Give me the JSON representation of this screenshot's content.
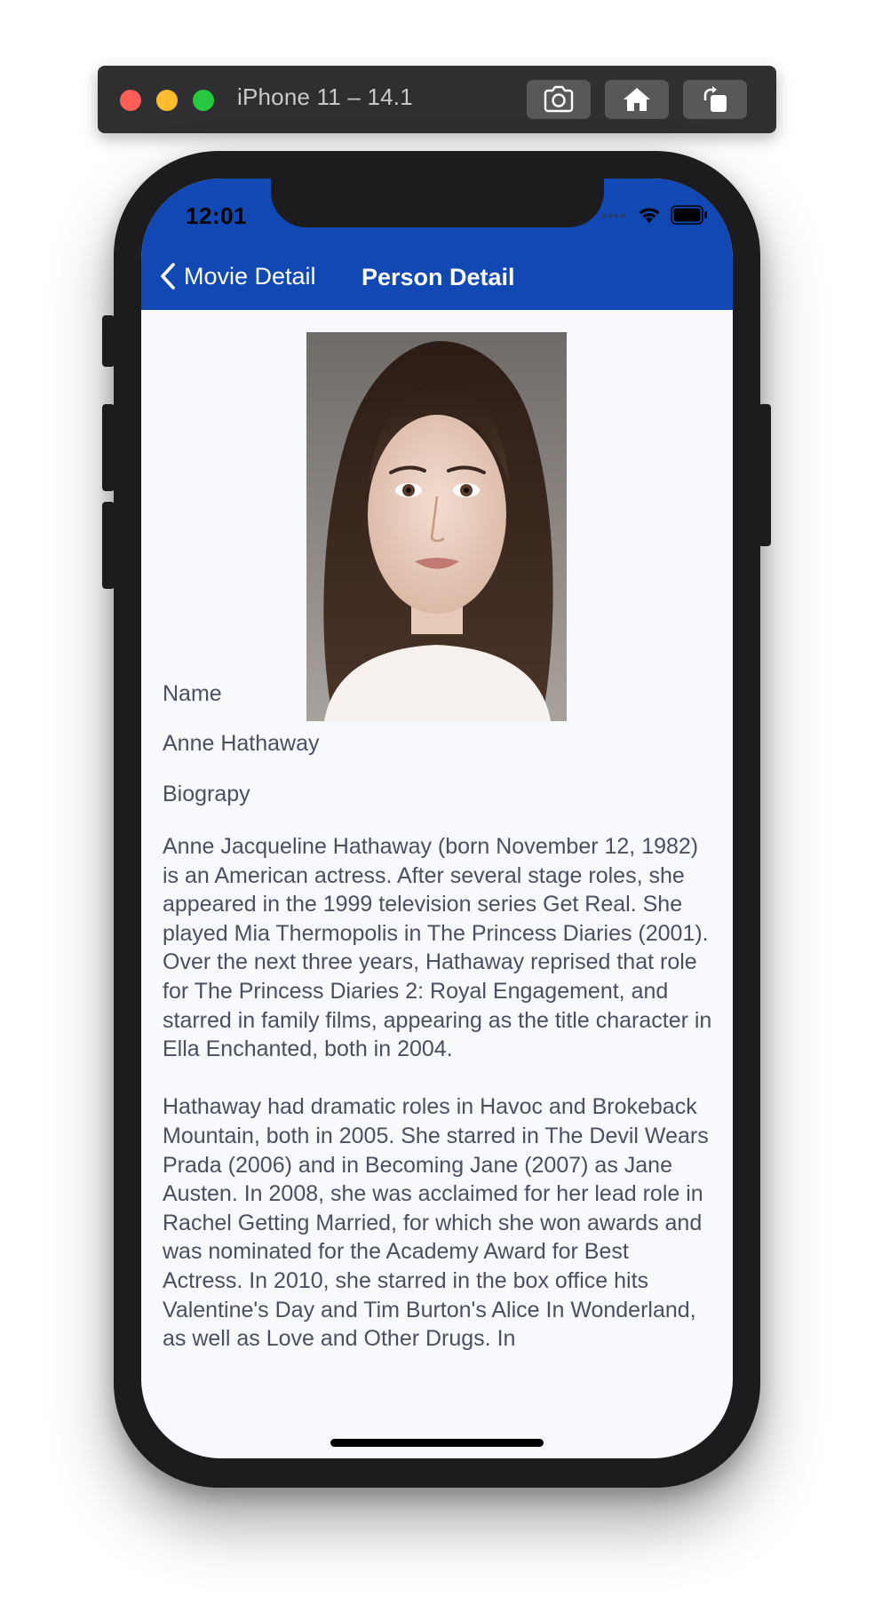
{
  "simulator": {
    "title": "iPhone 11 – 14.1",
    "buttons": [
      "screenshot-icon",
      "home-icon",
      "rotate-icon"
    ]
  },
  "status_bar": {
    "time": "12:01",
    "icons": [
      "signal-icon",
      "wifi-icon",
      "battery-icon"
    ]
  },
  "nav": {
    "back_label": "Movie Detail",
    "title": "Person Detail",
    "color": "#1148b4"
  },
  "person": {
    "photo_icon": "person-portrait",
    "name_label": "Name",
    "name": "Anne Hathaway",
    "bio_label": "Biograpy",
    "bio_paragraphs": [
      "Anne Jacqueline Hathaway (born November 12, 1982) is an American actress. After several stage roles, she appeared in the 1999 television series Get Real. She played Mia Thermopolis in The Princess Diaries (2001). Over the next three years, Hathaway reprised that role for The Princess Diaries 2: Royal Engagement, and starred in family films, appearing as the title character in Ella Enchanted, both in 2004.",
      "Hathaway had dramatic roles in Havoc and Brokeback Mountain, both in 2005. She starred in The Devil Wears Prada (2006) and in Becoming Jane (2007) as Jane Austen. In 2008, she was acclaimed for her lead role in Rachel Getting Married, for which she won awards and was nominated for the Academy Award for Best Actress. In 2010, she starred in the box office hits Valentine's Day and Tim Burton's Alice In Wonderland, as well as Love and Other Drugs. In"
    ]
  }
}
